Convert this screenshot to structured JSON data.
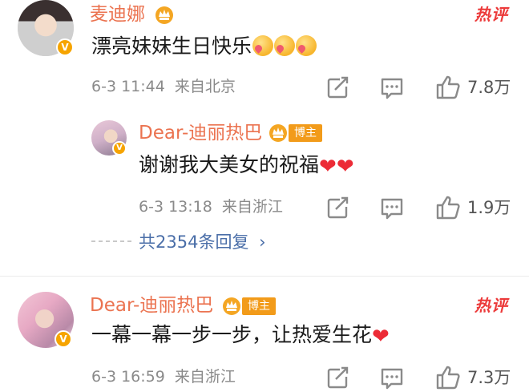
{
  "comments": [
    {
      "user": "麦迪娜",
      "hot_tag": "热评",
      "text": "漂亮妹妹生日快乐",
      "time": "6-3 11:44",
      "location": "来自北京",
      "likes": "7.8万",
      "verified": "V"
    },
    {
      "user": "Dear-迪丽热巴",
      "hot_tag": "热评",
      "blogger_tag": "博主",
      "text": "一幕一幕一步一步，让热爱生花",
      "time": "6-3 16:59",
      "location": "来自浙江",
      "likes": "7.3万",
      "verified": "V"
    }
  ],
  "reply": {
    "user": "Dear-迪丽热巴",
    "blogger_tag": "博主",
    "text": "谢谢我大美女的祝福",
    "time": "6-3 13:18",
    "location": "来自浙江",
    "likes": "1.9万",
    "verified": "V"
  },
  "more_replies": "共2354条回复",
  "icons": {
    "crown": "crown-badge-icon",
    "share": "share-icon",
    "comment": "comment-icon",
    "like": "thumbs-up-icon",
    "chevron": "chevron-right-icon",
    "heart": "red-heart-emoji",
    "emoji": "blush-heart-emoji"
  },
  "colors": {
    "username": "#eb7350",
    "hot_tag": "#ec3a3a",
    "reply_link": "#4a6ea8",
    "blogger_tag": "#f29b1a",
    "verified": "#f6a400"
  }
}
